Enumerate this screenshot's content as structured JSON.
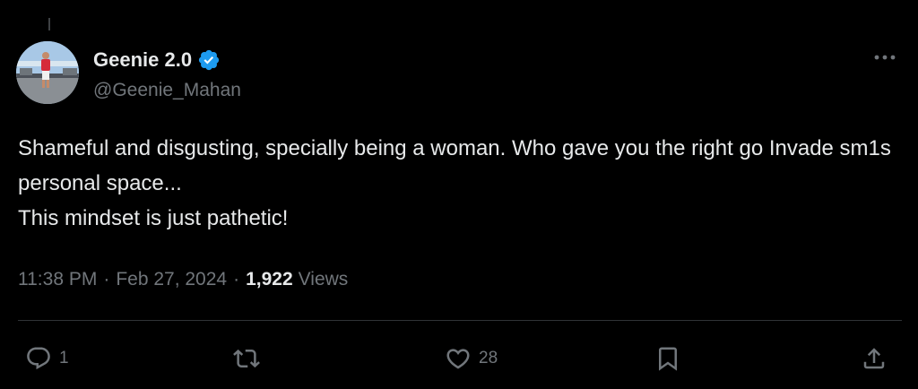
{
  "colors": {
    "background": "#000000",
    "primary_text": "#e7e9ea",
    "secondary_text": "#71767b",
    "verified_badge": "#1d9bf0",
    "divider": "#2f3336"
  },
  "author": {
    "display_name": "Geenie 2.0",
    "handle": "@Geenie_Mahan",
    "verified": true,
    "avatar_icon": "profile-photo"
  },
  "tweet": {
    "text": "Shameful and disgusting, specially being a woman. Who gave you the right go Invade sm1s personal space...\nThis mindset is just pathetic!",
    "time": "11:38 PM",
    "separator": "·",
    "date": "Feb 27, 2024",
    "views_count": "1,922",
    "views_label": "Views"
  },
  "actions": {
    "reply": {
      "icon": "reply-icon",
      "count": "1"
    },
    "repost": {
      "icon": "repost-icon",
      "count": ""
    },
    "like": {
      "icon": "heart-icon",
      "count": "28"
    },
    "bookmark": {
      "icon": "bookmark-icon"
    },
    "share": {
      "icon": "share-icon"
    }
  },
  "menu": {
    "icon": "more-options-icon"
  }
}
